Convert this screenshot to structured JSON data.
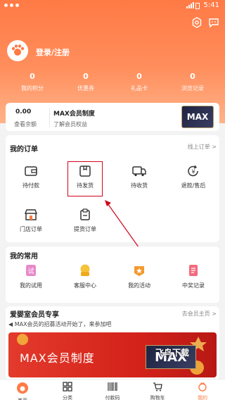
{
  "status_bar": {
    "time": "5:41"
  },
  "user": {
    "login_label": "登录/注册"
  },
  "stats": [
    {
      "value": "0",
      "label": "我的积分"
    },
    {
      "value": "0",
      "label": "优惠券"
    },
    {
      "value": "0",
      "label": "礼品卡"
    },
    {
      "value": "0",
      "label": "浏览记录"
    }
  ],
  "member": {
    "balance_value": "0.00",
    "balance_label": "查看余额",
    "title": "MAX会员制度",
    "subtitle": "了解会员权益",
    "thumb_text": "MAX"
  },
  "orders": {
    "title": "我的订单",
    "more": "线上订单 >",
    "items": [
      {
        "label": "待付款",
        "icon": "wallet-icon"
      },
      {
        "label": "待发货",
        "icon": "box-icon"
      },
      {
        "label": "待收货",
        "icon": "truck-icon"
      },
      {
        "label": "退款/售后",
        "icon": "refund-icon"
      },
      {
        "label": "门店订单",
        "icon": "store-icon"
      },
      {
        "label": "提货订单",
        "icon": "pickup-icon"
      }
    ]
  },
  "common": {
    "title": "我的常用",
    "items": [
      {
        "label": "我的试用",
        "icon": "trial-icon"
      },
      {
        "label": "客服中心",
        "icon": "service-icon"
      },
      {
        "label": "我的活动",
        "icon": "activity-icon"
      },
      {
        "label": "中奖记录",
        "icon": "prize-icon"
      }
    ]
  },
  "vip": {
    "title": "爱婴室会员专享",
    "more": "去会员主页 >",
    "notice": "◀ MAX会员的招募活动开始了，来参加吧",
    "banner_title": "MAX会员制度",
    "banner_max": "MAX",
    "watermark": "飞鸟下载"
  },
  "tabs": [
    {
      "label": "首页",
      "icon": "home-icon"
    },
    {
      "label": "分类",
      "icon": "category-icon"
    },
    {
      "label": "付款码",
      "icon": "paycode-icon"
    },
    {
      "label": "购物车",
      "icon": "cart-icon"
    },
    {
      "label": "我的",
      "icon": "profile-icon"
    }
  ],
  "colors": {
    "accent": "#ff7a45",
    "highlight": "#d0021b"
  }
}
